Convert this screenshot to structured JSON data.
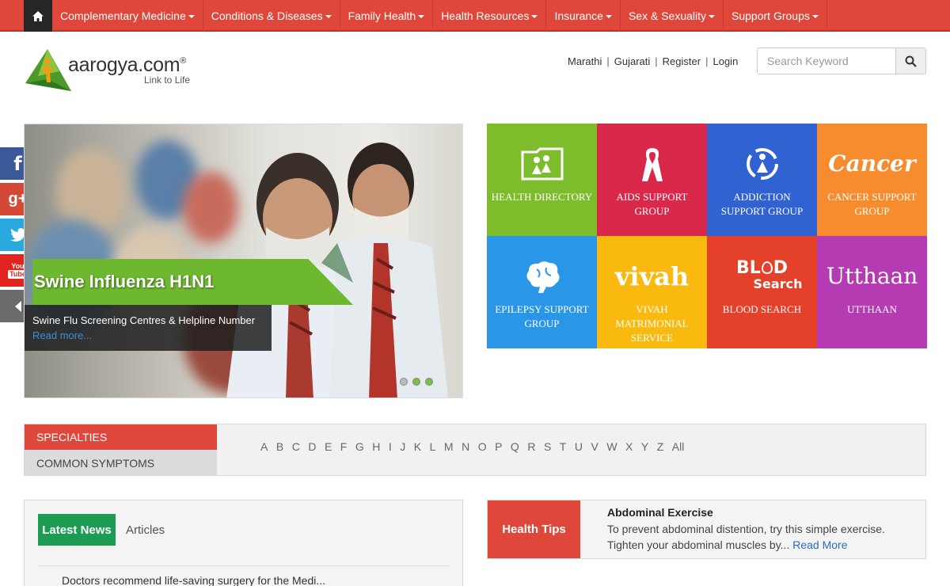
{
  "nav": {
    "home_icon": "home-icon",
    "items": [
      {
        "label": "Complementary Medicine"
      },
      {
        "label": "Conditions & Diseases"
      },
      {
        "label": "Family Health"
      },
      {
        "label": "Health Resources"
      },
      {
        "label": "Insurance"
      },
      {
        "label": "Sex & Sexuality"
      },
      {
        "label": "Support Groups"
      }
    ]
  },
  "logo": {
    "name": "aarogya.com",
    "reg": "®",
    "tagline": "Link to Life"
  },
  "toplinks": [
    "Marathi",
    "Gujarati",
    "Register",
    "Login"
  ],
  "search": {
    "placeholder": "Search Keyword",
    "icon": "search-icon"
  },
  "social": {
    "facebook": "f",
    "google": "g+",
    "youtube_top": "You",
    "youtube_bottom": "Tube"
  },
  "slider": {
    "title": "Swine Influenza H1N1",
    "caption": "Swine Flu Screening Centres & Helpline Number",
    "read_more": "Read more...",
    "dots": 3,
    "active_dot": 1
  },
  "tiles": [
    {
      "label": "HEALTH DIRECTORY",
      "color": "#7dbc2a",
      "icon": "folder-people-icon"
    },
    {
      "label": "AIDS SUPPORT GROUP",
      "color": "#d9284a",
      "icon": "ribbon-icon"
    },
    {
      "label": "ADDICTION SUPPORT GROUP",
      "color": "#3162d1",
      "icon": "addiction-icon"
    },
    {
      "label": "CANCER SUPPORT GROUP",
      "color": "#f78c2e",
      "icon": "cancer-logo-icon",
      "logo_text": "Cancer"
    },
    {
      "label": "EPILEPSY SUPPORT GROUP",
      "color": "#2a96e8",
      "icon": "brain-icon"
    },
    {
      "label": "VIVAH MATRIMONIAL SERVICE",
      "color": "#f9b90f",
      "icon": "vivah-logo-icon",
      "logo_text": "vivah"
    },
    {
      "label": "BLOOD SEARCH",
      "color": "#e5402a",
      "icon": "blood-search-logo-icon",
      "logo_text_1": "BL",
      "logo_text_2": "D",
      "logo_text_3": "Search"
    },
    {
      "label": "UTTHAAN",
      "color": "#b53bb3",
      "icon": "utthaan-logo-icon",
      "logo_text": "Utthaan"
    }
  ],
  "specialties": {
    "tab_specialties": "SPECIALTIES",
    "tab_symptoms": "COMMON SYMPTOMS",
    "letters": [
      "A",
      "B",
      "C",
      "D",
      "E",
      "F",
      "G",
      "H",
      "I",
      "J",
      "K",
      "L",
      "M",
      "N",
      "O",
      "P",
      "Q",
      "R",
      "S",
      "T",
      "U",
      "V",
      "W",
      "X",
      "Y",
      "Z",
      "All"
    ]
  },
  "news": {
    "tab_latest": "Latest News",
    "tab_articles": "Articles",
    "item": "Doctors recommend life-saving surgery for the Medi..."
  },
  "tips": {
    "label": "Health Tips",
    "title": "Abdominal Exercise",
    "text": "To prevent abdominal distention, try this simple exercise. Tighten your abdominal muscles by...",
    "read_more": "Read More"
  }
}
